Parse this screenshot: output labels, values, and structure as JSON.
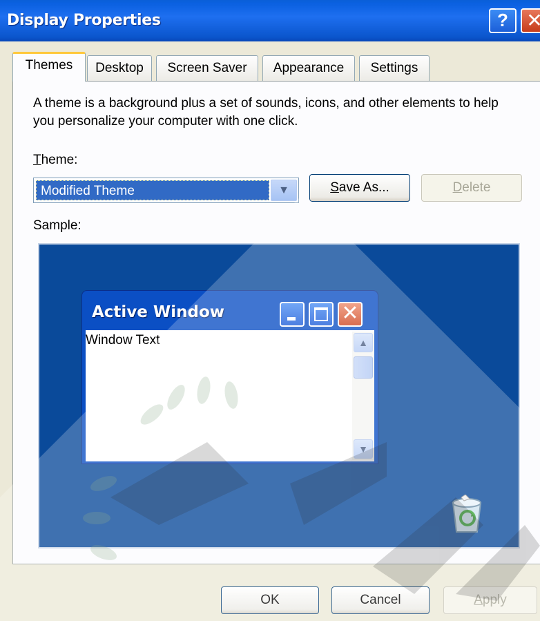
{
  "window": {
    "title": "Display Properties",
    "help_glyph": "?",
    "close_glyph": "✕"
  },
  "tabs": [
    {
      "label": "Themes",
      "active": true
    },
    {
      "label": "Desktop",
      "active": false
    },
    {
      "label": "Screen Saver",
      "active": false
    },
    {
      "label": "Appearance",
      "active": false
    },
    {
      "label": "Settings",
      "active": false
    }
  ],
  "themes_page": {
    "description": "A theme is a background plus a set of sounds, icons, and other elements to help you personalize your computer with one click.",
    "theme_label_first": "T",
    "theme_label_rest": "heme:",
    "theme_value": "Modified Theme",
    "save_as_first": "S",
    "save_as_rest": "ave As...",
    "delete_first": "D",
    "delete_rest": "elete",
    "sample_label": "Sample:"
  },
  "sample": {
    "window_title": "Active Window",
    "window_text": "Window Text"
  },
  "footer": {
    "ok_label": "OK",
    "cancel_label": "Cancel",
    "apply_first": "A",
    "apply_rest": "pply"
  },
  "colors": {
    "titlebar": "#0a55cc",
    "selection": "#316ac5",
    "desktop": "#0a4a9a",
    "tab_highlight": "#ffc83c"
  }
}
